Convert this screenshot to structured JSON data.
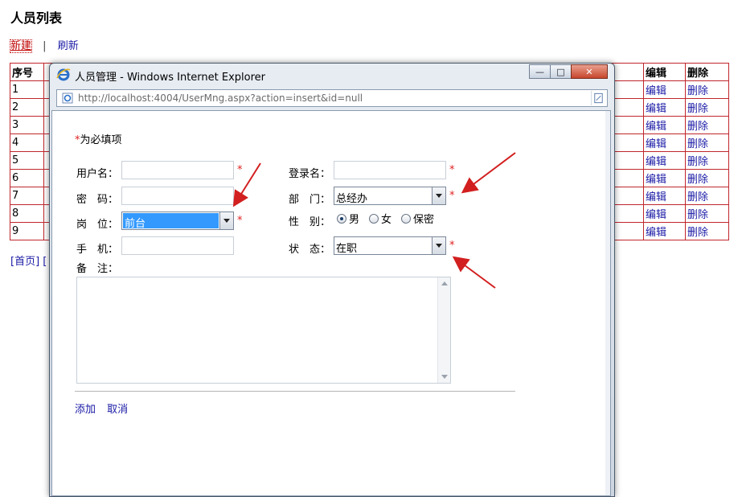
{
  "page": {
    "title": "人员列表",
    "new_link": "新建",
    "sep": "|",
    "refresh_link": "刷新",
    "pager_text": "[首页] [",
    "table": {
      "headers": {
        "no": "序号",
        "edit": "编辑",
        "delete": "删除"
      },
      "rows": [
        {
          "no": "1",
          "edit": "编辑",
          "delete": "删除"
        },
        {
          "no": "2",
          "edit": "编辑",
          "delete": "删除"
        },
        {
          "no": "3",
          "edit": "编辑",
          "delete": "删除"
        },
        {
          "no": "4",
          "edit": "编辑",
          "delete": "删除"
        },
        {
          "no": "5",
          "edit": "编辑",
          "delete": "删除"
        },
        {
          "no": "6",
          "edit": "编辑",
          "delete": "删除"
        },
        {
          "no": "7",
          "edit": "编辑",
          "delete": "删除"
        },
        {
          "no": "8",
          "edit": "编辑",
          "delete": "删除"
        },
        {
          "no": "9",
          "edit": "编辑",
          "delete": "删除"
        }
      ]
    }
  },
  "dialog": {
    "title": "人员管理 - Windows Internet Explorer",
    "url": "http://localhost:4004/UserMng.aspx?action=insert&id=null",
    "window_buttons": {
      "minimize": "—",
      "maximize": "□",
      "close": "✕"
    },
    "form": {
      "required_note_star": "*",
      "required_note": "为必填项",
      "username_label": "用户名：",
      "password_label": "密　码：",
      "position_label": "岗　位：",
      "position_value": "前台",
      "mobile_label": "手　机：",
      "remark_label": "备　注：",
      "login_label": "登录名：",
      "dept_label": "部　门：",
      "dept_value": "总经办",
      "gender_label": "性　别：",
      "gender_options": {
        "male": "男",
        "female": "女",
        "secret": "保密"
      },
      "status_label": "状　态：",
      "status_value": "在职",
      "star": "*"
    },
    "actions": {
      "add": "添加",
      "cancel": "取消"
    }
  },
  "colors": {
    "accent_red": "#e02020",
    "link_blue": "#1a1aa6",
    "table_border": "#c0262c",
    "selection": "#3399ff"
  }
}
